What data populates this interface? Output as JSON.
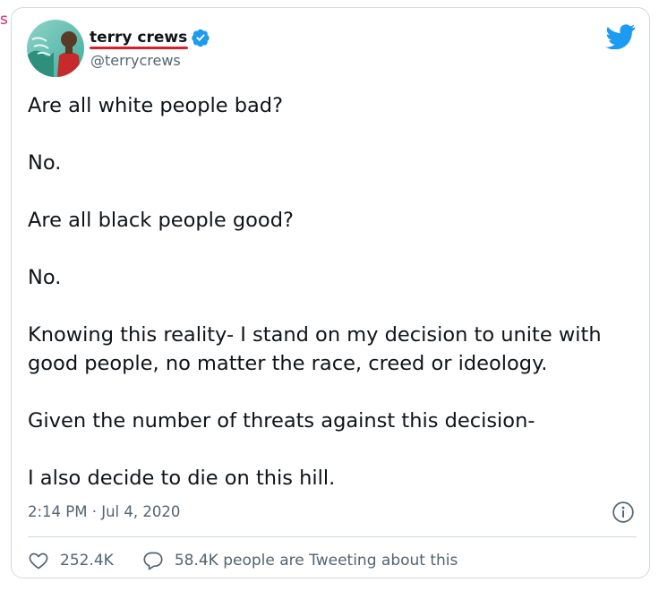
{
  "edge_fragment": "s",
  "tweet": {
    "display_name": "terry crews",
    "handle": "@terrycrews",
    "paragraphs": [
      "Are all white people bad?",
      "No.",
      "Are all black people good?",
      "No.",
      "Knowing this reality- I stand on my decision to unite with good people, no matter the race, creed or ideology.",
      "Given the number of threats against this decision-",
      "I also decide to die on this hill."
    ],
    "timestamp": "2:14 PM · Jul 4, 2020",
    "like_count": "252.4K",
    "conversation_text": "58.4K people are Tweeting about this"
  },
  "icons": {
    "avatar": "avatar-image",
    "verified": "verified-badge-icon",
    "brand": "twitter-bird-icon",
    "info": "info-icon",
    "like": "heart-icon",
    "reply": "speech-bubble-icon"
  },
  "colors": {
    "brand_blue": "#1d9bf0",
    "text_primary": "#0f1419",
    "text_secondary": "#536471",
    "border": "#cfd9de",
    "underline_annotation": "#d8202a",
    "edge_fragment": "#e0245e"
  }
}
